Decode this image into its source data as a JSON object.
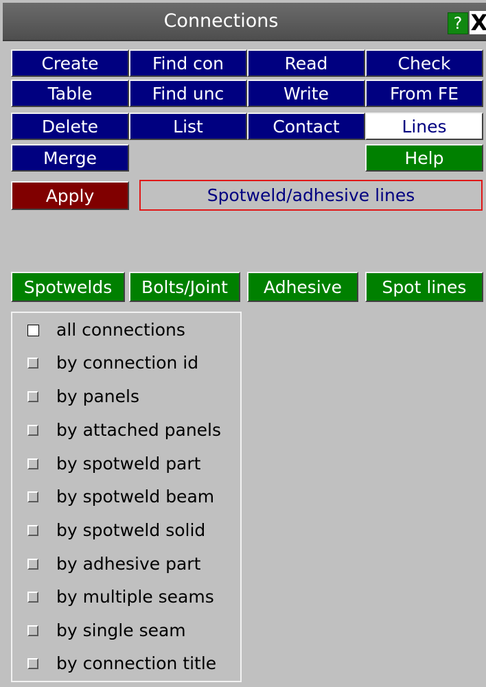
{
  "window": {
    "title": "Connections",
    "help_label": "?",
    "close_label": "X"
  },
  "toolbar": {
    "create": "Create",
    "find_con": "Find con",
    "read": "Read",
    "check": "Check",
    "table": "Table",
    "find_unc": "Find unc",
    "write": "Write",
    "from_fe": "From FE",
    "delete": "Delete",
    "list": "List",
    "contact": "Contact",
    "lines": "Lines",
    "merge": "Merge",
    "help": "Help"
  },
  "apply_label": "Apply",
  "mode_label": "Spotweld/adhesive lines",
  "tabs": [
    "Spotwelds",
    "Bolts/Joint",
    "Adhesive",
    "Spot lines"
  ],
  "selection": {
    "items": [
      {
        "label": "all connections",
        "checked": true
      },
      {
        "label": "by connection id",
        "checked": false
      },
      {
        "label": "by panels",
        "checked": false
      },
      {
        "label": "by attached panels",
        "checked": false
      },
      {
        "label": "by spotweld part",
        "checked": false
      },
      {
        "label": "by spotweld beam",
        "checked": false
      },
      {
        "label": "by spotweld solid",
        "checked": false
      },
      {
        "label": "by adhesive part",
        "checked": false
      },
      {
        "label": "by multiple seams",
        "checked": false
      },
      {
        "label": "by single seam",
        "checked": false
      },
      {
        "label": "by connection title",
        "checked": false
      }
    ]
  },
  "colors": {
    "button_blue": "#000080",
    "button_green": "#008000",
    "apply_maroon": "#800000",
    "mode_border": "#e01818",
    "panel_bg": "#c0c0c0"
  }
}
